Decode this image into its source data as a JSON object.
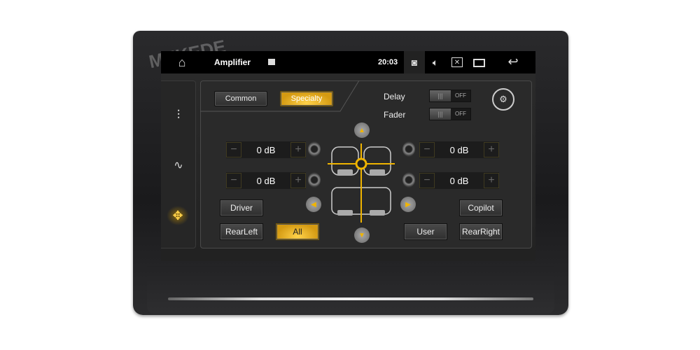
{
  "watermark": "MEKEDE",
  "status_bar": {
    "title": "Amplifier",
    "time": "20:03",
    "icons": [
      "home-icon",
      "image-icon",
      "camera-icon",
      "volume-icon",
      "close-app-icon",
      "recent-apps-icon",
      "back-icon"
    ]
  },
  "sidebar": {
    "items": [
      {
        "icon": "equalizer-sliders-icon"
      },
      {
        "icon": "waveform-icon"
      },
      {
        "icon": "balance-fader-icon",
        "active": true
      }
    ]
  },
  "tabs": [
    {
      "label": "Common",
      "active": false
    },
    {
      "label": "Specialty",
      "active": true
    }
  ],
  "toggles": [
    {
      "label": "Delay",
      "state": "OFF"
    },
    {
      "label": "Fader",
      "state": "OFF"
    }
  ],
  "channels": {
    "front_left": "0 dB",
    "rear_left": "0 dB",
    "front_right": "0 dB",
    "rear_right": "0 dB"
  },
  "buttons": {
    "driver": "Driver",
    "rear_left": "RearLeft",
    "all": "All",
    "user": "User",
    "copilot": "Copilot",
    "rear_right": "RearRight"
  },
  "accent": "#f0b400"
}
